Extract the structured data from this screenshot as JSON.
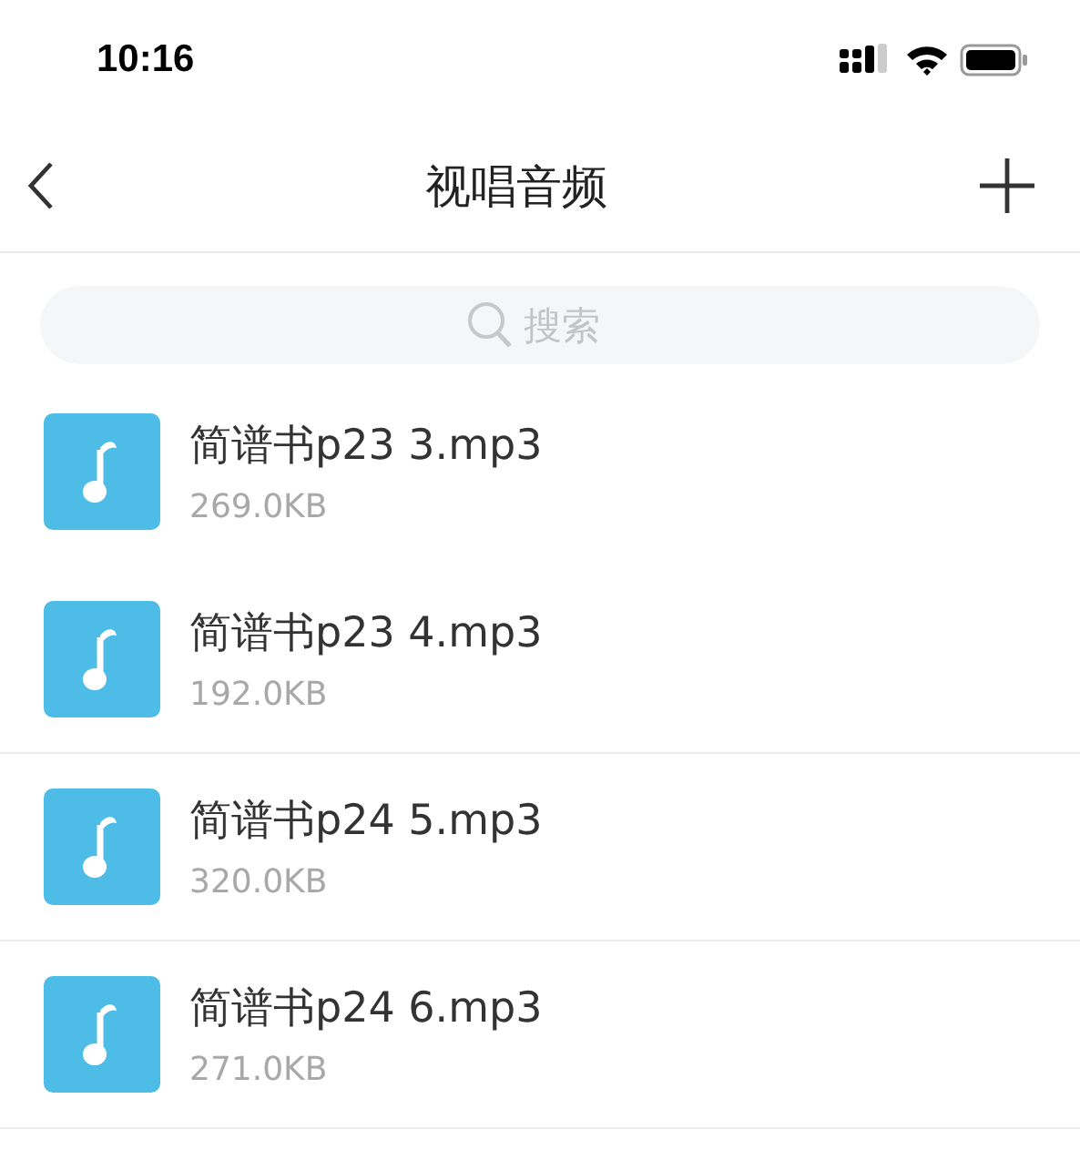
{
  "status_bar": {
    "time": "10:16"
  },
  "nav": {
    "title": "视唱音频"
  },
  "search": {
    "placeholder": "搜索"
  },
  "files": [
    {
      "name": "简谱书p23 3.mp3",
      "size": "269.0KB",
      "divider": false
    },
    {
      "name": "简谱书p23 4.mp3",
      "size": "192.0KB",
      "divider": true
    },
    {
      "name": "简谱书p24 5.mp3",
      "size": "320.0KB",
      "divider": true
    },
    {
      "name": "简谱书p24 6.mp3",
      "size": "271.0KB",
      "divider": true
    }
  ]
}
